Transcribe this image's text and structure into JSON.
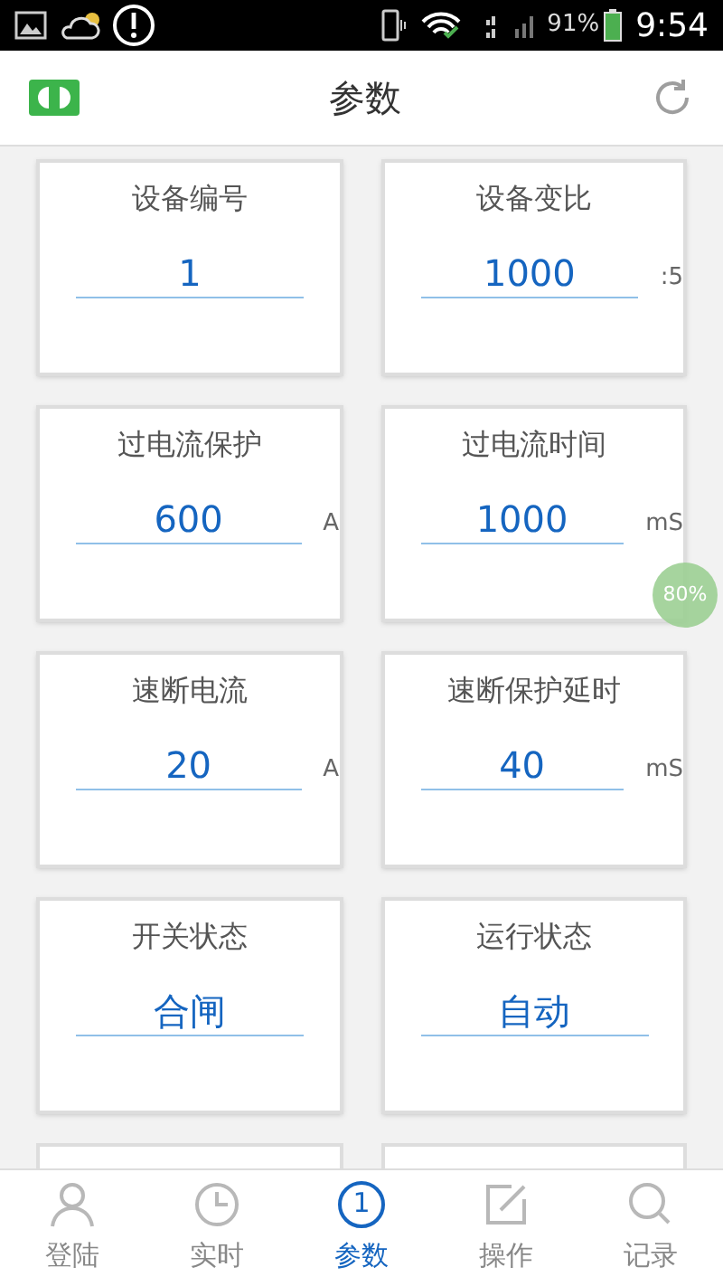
{
  "status_bar": {
    "battery": "91%",
    "time": "9:54"
  },
  "header": {
    "title": "参数"
  },
  "cards": [
    {
      "label": "设备编号",
      "value": "1"
    },
    {
      "label": "设备变比",
      "value": "1000",
      "unit": ":5"
    },
    {
      "label": "过电流保护",
      "value": "600",
      "unit": "A"
    },
    {
      "label": "过电流时间",
      "value": "1000",
      "unit": "mS"
    },
    {
      "label": "速断电流",
      "value": "20",
      "unit": "A"
    },
    {
      "label": "速断保护延时",
      "value": "40",
      "unit": "mS"
    },
    {
      "label": "开关状态",
      "value": "合闸"
    },
    {
      "label": "运行状态",
      "value": "自动"
    }
  ],
  "floating_badge": "80%",
  "tabs": [
    {
      "label": "登陆",
      "kind": "user",
      "selected": false
    },
    {
      "label": "实时",
      "kind": "clock",
      "selected": false
    },
    {
      "label": "参数",
      "kind": "number",
      "icon_text": "1",
      "selected": true
    },
    {
      "label": "操作",
      "kind": "edit",
      "selected": false
    },
    {
      "label": "记录",
      "kind": "search",
      "selected": false
    }
  ]
}
